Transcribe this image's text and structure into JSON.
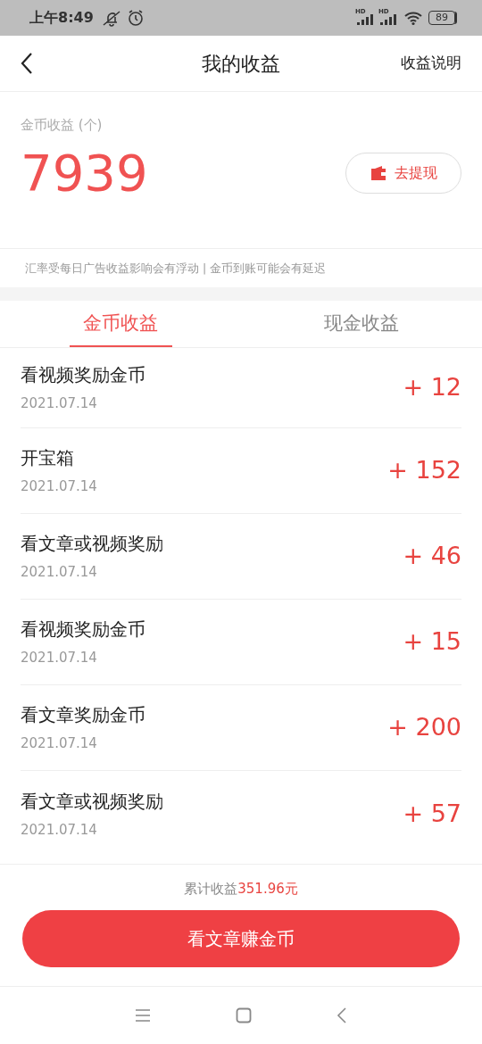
{
  "status_bar": {
    "time": "上午8:49",
    "signal_labels": [
      "HD",
      "HD"
    ],
    "battery": "89"
  },
  "header": {
    "title": "我的收益",
    "action": "收益说明"
  },
  "summary": {
    "label": "金币收益 (个)",
    "amount": "7939",
    "withdraw_button": "去提现",
    "note": "汇率受每日广告收益影响会有浮动 | 金币到账可能会有延迟"
  },
  "tabs": [
    {
      "label": "金币收益",
      "selected": true
    },
    {
      "label": "现金收益",
      "selected": false
    }
  ],
  "records": [
    {
      "title": "看视频奖励金币",
      "date": "2021.07.14",
      "amount": "+ 12"
    },
    {
      "title": "开宝箱",
      "date": "2021.07.14",
      "amount": "+ 152"
    },
    {
      "title": "看文章或视频奖励",
      "date": "2021.07.14",
      "amount": "+ 46"
    },
    {
      "title": "看视频奖励金币",
      "date": "2021.07.14",
      "amount": "+ 15"
    },
    {
      "title": "看文章奖励金币",
      "date": "2021.07.14",
      "amount": "+ 200"
    },
    {
      "title": "看文章或视频奖励",
      "date": "2021.07.14",
      "amount": "+ 57"
    }
  ],
  "footer": {
    "total_label": "累计收益",
    "total_value": "351.96元",
    "button": "看文章赚金币"
  }
}
